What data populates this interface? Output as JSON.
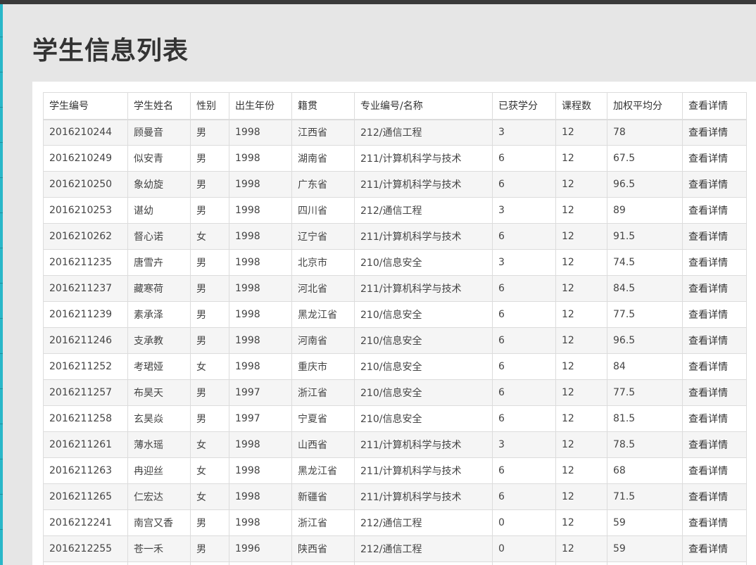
{
  "page": {
    "title": "学生信息列表"
  },
  "table": {
    "headers": [
      "学生编号",
      "学生姓名",
      "性别",
      "出生年份",
      "籍贯",
      "专业编号/名称",
      "已获学分",
      "课程数",
      "加权平均分",
      "查看详情"
    ],
    "rows": [
      [
        "2016210244",
        "顾曼音",
        "男",
        "1998",
        "江西省",
        "212/通信工程",
        "3",
        "12",
        "78",
        "查看详情"
      ],
      [
        "2016210249",
        "似安青",
        "男",
        "1998",
        "湖南省",
        "211/计算机科学与技术",
        "6",
        "12",
        "67.5",
        "查看详情"
      ],
      [
        "2016210250",
        "象幼旋",
        "男",
        "1998",
        "广东省",
        "211/计算机科学与技术",
        "6",
        "12",
        "96.5",
        "查看详情"
      ],
      [
        "2016210253",
        "谌幼",
        "男",
        "1998",
        "四川省",
        "212/通信工程",
        "3",
        "12",
        "89",
        "查看详情"
      ],
      [
        "2016210262",
        "督心诺",
        "女",
        "1998",
        "辽宁省",
        "211/计算机科学与技术",
        "6",
        "12",
        "91.5",
        "查看详情"
      ],
      [
        "2016211235",
        "唐雪卉",
        "男",
        "1998",
        "北京市",
        "210/信息安全",
        "3",
        "12",
        "74.5",
        "查看详情"
      ],
      [
        "2016211237",
        "藏寒荷",
        "男",
        "1998",
        "河北省",
        "211/计算机科学与技术",
        "6",
        "12",
        "84.5",
        "查看详情"
      ],
      [
        "2016211239",
        "素承泽",
        "男",
        "1998",
        "黑龙江省",
        "210/信息安全",
        "6",
        "12",
        "77.5",
        "查看详情"
      ],
      [
        "2016211246",
        "支承教",
        "男",
        "1998",
        "河南省",
        "210/信息安全",
        "6",
        "12",
        "96.5",
        "查看详情"
      ],
      [
        "2016211252",
        "考珺娅",
        "女",
        "1998",
        "重庆市",
        "210/信息安全",
        "6",
        "12",
        "84",
        "查看详情"
      ],
      [
        "2016211257",
        "布昊天",
        "男",
        "1997",
        "浙江省",
        "210/信息安全",
        "6",
        "12",
        "77.5",
        "查看详情"
      ],
      [
        "2016211258",
        "玄昊焱",
        "男",
        "1997",
        "宁夏省",
        "210/信息安全",
        "6",
        "12",
        "81.5",
        "查看详情"
      ],
      [
        "2016211261",
        "薄水瑶",
        "女",
        "1998",
        "山西省",
        "211/计算机科学与技术",
        "3",
        "12",
        "78.5",
        "查看详情"
      ],
      [
        "2016211263",
        "冉迎丝",
        "女",
        "1998",
        "黑龙江省",
        "211/计算机科学与技术",
        "6",
        "12",
        "68",
        "查看详情"
      ],
      [
        "2016211265",
        "仁宏达",
        "女",
        "1998",
        "新疆省",
        "211/计算机科学与技术",
        "6",
        "12",
        "71.5",
        "查看详情"
      ],
      [
        "2016212241",
        "南宫又香",
        "男",
        "1998",
        "浙江省",
        "212/通信工程",
        "0",
        "12",
        "59",
        "查看详情"
      ],
      [
        "2016212255",
        "苍一禾",
        "男",
        "1996",
        "陕西省",
        "212/通信工程",
        "0",
        "12",
        "59",
        "查看详情"
      ],
      [
        "",
        "",
        "",
        "",
        "",
        "",
        "",
        "",
        "",
        ""
      ]
    ]
  },
  "colors": {
    "top_bar": "#3a3a3a",
    "left_accent": "#2ab7c9",
    "page_background": "#e6e6e6",
    "panel_background": "#ffffff",
    "stripe": "#f5f5f5",
    "border": "#dcdcdc"
  }
}
